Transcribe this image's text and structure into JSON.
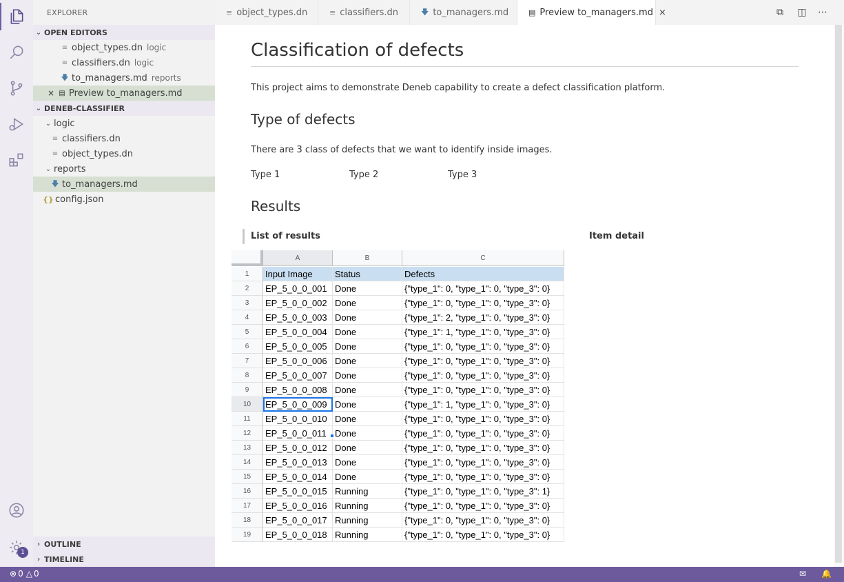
{
  "activity_bar": {
    "icons": [
      "explorer-icon",
      "search-icon",
      "source-control-icon",
      "run-debug-icon",
      "extensions-icon",
      "account-icon",
      "settings-gear-icon"
    ],
    "settings_badge": "1"
  },
  "sidebar": {
    "title": "EXPLORER",
    "open_editors": {
      "label": "OPEN EDITORS",
      "items": [
        {
          "name": "object_types.dn",
          "desc": "logic"
        },
        {
          "name": "classifiers.dn",
          "desc": "logic"
        },
        {
          "name": "to_managers.md",
          "desc": "reports"
        },
        {
          "name": "Preview to_managers.md",
          "desc": ""
        }
      ]
    },
    "project": {
      "label": "DENEB-CLASSIFIER",
      "folder_logic": "logic",
      "logic_files": [
        "classifiers.dn",
        "object_types.dn"
      ],
      "folder_reports": "reports",
      "reports_files": [
        "to_managers.md"
      ],
      "root_files": [
        "config.json"
      ]
    },
    "outline_label": "OUTLINE",
    "timeline_label": "TIMELINE"
  },
  "tabs": [
    {
      "label": "object_types.dn",
      "icon": "file-lines-icon"
    },
    {
      "label": "classifiers.dn",
      "icon": "file-lines-icon"
    },
    {
      "label": "to_managers.md",
      "icon": "markdown-icon"
    },
    {
      "label": "Preview to_managers.md",
      "icon": "preview-icon",
      "active": true
    }
  ],
  "preview": {
    "title": "Classification of defects",
    "intro": "This project aims to demonstrate Deneb capability to create a defect classification platform.",
    "h2_types": "Type of defects",
    "types_text": "There are 3 class of defects that we want to identify inside images.",
    "type_labels": [
      "Type 1",
      "Type 2",
      "Type 3"
    ],
    "h2_results": "Results",
    "list_label": "List of results",
    "detail_label": "Item detail"
  },
  "sheet": {
    "columns": [
      "A",
      "B",
      "C"
    ],
    "selected_column": "A",
    "selected_row": 10,
    "header_row": {
      "num": "1",
      "cells": [
        "Input Image",
        "Status",
        "Defects"
      ]
    },
    "rows": [
      {
        "num": "2",
        "cells": [
          "EP_5_0_0_001",
          "Done",
          "{\"type_1\": 0, \"type_1\": 0, \"type_3\": 0}"
        ]
      },
      {
        "num": "3",
        "cells": [
          "EP_5_0_0_002",
          "Done",
          "{\"type_1\": 0, \"type_1\": 0, \"type_3\": 0}"
        ]
      },
      {
        "num": "4",
        "cells": [
          "EP_5_0_0_003",
          "Done",
          "{\"type_1\": 2, \"type_1\": 0, \"type_3\": 0}"
        ]
      },
      {
        "num": "5",
        "cells": [
          "EP_5_0_0_004",
          "Done",
          "{\"type_1\": 1, \"type_1\": 0, \"type_3\": 0}"
        ]
      },
      {
        "num": "6",
        "cells": [
          "EP_5_0_0_005",
          "Done",
          "{\"type_1\": 0, \"type_1\": 0, \"type_3\": 0}"
        ]
      },
      {
        "num": "7",
        "cells": [
          "EP_5_0_0_006",
          "Done",
          "{\"type_1\": 0, \"type_1\": 0, \"type_3\": 0}"
        ]
      },
      {
        "num": "8",
        "cells": [
          "EP_5_0_0_007",
          "Done",
          "{\"type_1\": 0, \"type_1\": 0, \"type_3\": 0}"
        ]
      },
      {
        "num": "9",
        "cells": [
          "EP_5_0_0_008",
          "Done",
          "{\"type_1\": 0, \"type_1\": 0, \"type_3\": 0}"
        ]
      },
      {
        "num": "10",
        "cells": [
          "EP_5_0_0_009",
          "Done",
          "{\"type_1\": 1, \"type_1\": 0, \"type_3\": 0}"
        ]
      },
      {
        "num": "11",
        "cells": [
          "EP_5_0_0_010",
          "Done",
          "{\"type_1\": 0, \"type_1\": 0, \"type_3\": 0}"
        ]
      },
      {
        "num": "12",
        "cells": [
          "EP_5_0_0_011",
          "Done",
          "{\"type_1\": 0, \"type_1\": 0, \"type_3\": 0}"
        ]
      },
      {
        "num": "13",
        "cells": [
          "EP_5_0_0_012",
          "Done",
          "{\"type_1\": 0, \"type_1\": 0, \"type_3\": 0}"
        ]
      },
      {
        "num": "14",
        "cells": [
          "EP_5_0_0_013",
          "Done",
          "{\"type_1\": 0, \"type_1\": 0, \"type_3\": 0}"
        ]
      },
      {
        "num": "15",
        "cells": [
          "EP_5_0_0_014",
          "Done",
          "{\"type_1\": 0, \"type_1\": 0, \"type_3\": 0}"
        ]
      },
      {
        "num": "16",
        "cells": [
          "EP_5_0_0_015",
          "Running",
          "{\"type_1\": 0, \"type_1\": 0, \"type_3\": 1}"
        ]
      },
      {
        "num": "17",
        "cells": [
          "EP_5_0_0_016",
          "Running",
          "{\"type_1\": 0, \"type_1\": 0, \"type_3\": 0}"
        ]
      },
      {
        "num": "18",
        "cells": [
          "EP_5_0_0_017",
          "Running",
          "{\"type_1\": 0, \"type_1\": 0, \"type_3\": 0}"
        ]
      },
      {
        "num": "19",
        "cells": [
          "EP_5_0_0_018",
          "Running",
          "{\"type_1\": 0, \"type_1\": 0, \"type_3\": 0}"
        ]
      }
    ]
  },
  "status_bar": {
    "errors": "0",
    "warnings": "0",
    "icons": [
      "error-icon",
      "warning-icon",
      "feedback-icon",
      "bell-icon"
    ],
    "background": "#6c5a9c"
  }
}
